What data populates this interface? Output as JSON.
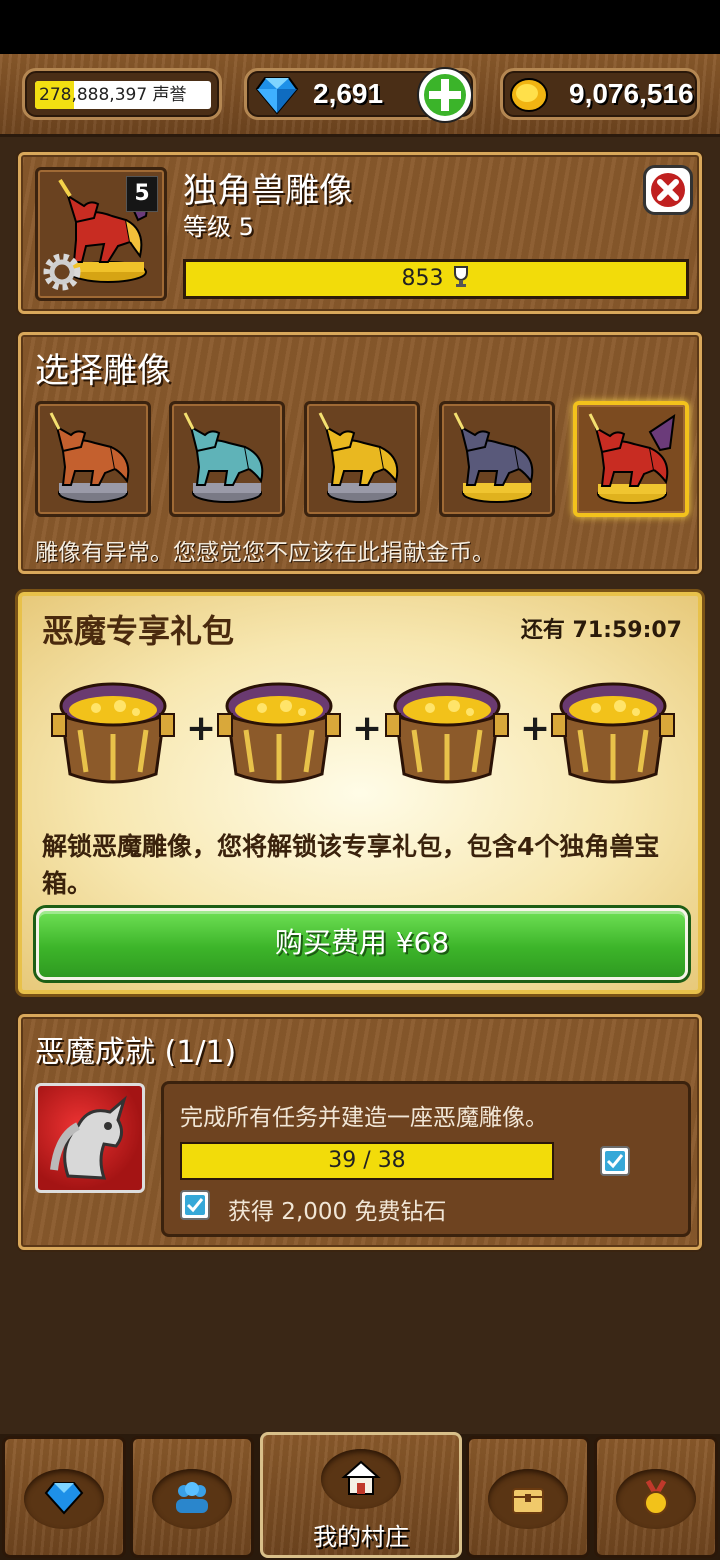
{
  "top_bar": {
    "reputation_text": "278,888,397 声誉",
    "reputation_progress": 0.22,
    "gems": "2,691",
    "gold": "9,076,516",
    "gem_icon": "diamond-icon",
    "add_icon": "plus-icon",
    "gold_icon": "gold-coin-icon"
  },
  "statue_header": {
    "title": "独角兽雕像",
    "level_text": "等级 5",
    "level_badge": "5",
    "trophies": "853",
    "trophy_icon": "trophy-icon",
    "close_icon": "close-icon",
    "settings_icon": "gear-icon"
  },
  "select_statue": {
    "title": "选择雕像",
    "options": [
      {
        "name": "copper-unicorn-statue",
        "color": "#c4602e"
      },
      {
        "name": "crystal-unicorn-statue",
        "color": "#5fb3b8"
      },
      {
        "name": "golden-unicorn-statue",
        "color": "#e9b820"
      },
      {
        "name": "dark-unicorn-statue",
        "color": "#59597a"
      },
      {
        "name": "demon-unicorn-statue",
        "color": "#c82c22"
      }
    ],
    "selected_index": 4,
    "message": "雕像有异常。您感觉您不应该在此捐献金币。"
  },
  "offer": {
    "title": "恶魔专享礼包",
    "timer": "还有 71:59:07",
    "chest_count": 4,
    "plus_sign": "+",
    "description": "解锁恶魔雕像，您将解锁该专享礼包，包含4个独角兽宝箱。",
    "buy_label": "购买费用 ¥68"
  },
  "achievement": {
    "title": "恶魔成就 (1/1)",
    "task_text": "完成所有任务并建造一座恶魔雕像。",
    "progress_text": "39 / 38",
    "progress": 1.0,
    "reward_text": "获得 2,000 免费钻石"
  },
  "bottom_nav": {
    "items": [
      {
        "name": "nav-shop",
        "icon": "diamond-icon",
        "label": ""
      },
      {
        "name": "nav-friends",
        "icon": "people-icon",
        "label": ""
      },
      {
        "name": "nav-village",
        "icon": "house-icon",
        "label": "我的村庄"
      },
      {
        "name": "nav-chest",
        "icon": "chest-icon",
        "label": ""
      },
      {
        "name": "nav-achievements",
        "icon": "medal-icon",
        "label": ""
      }
    ]
  }
}
